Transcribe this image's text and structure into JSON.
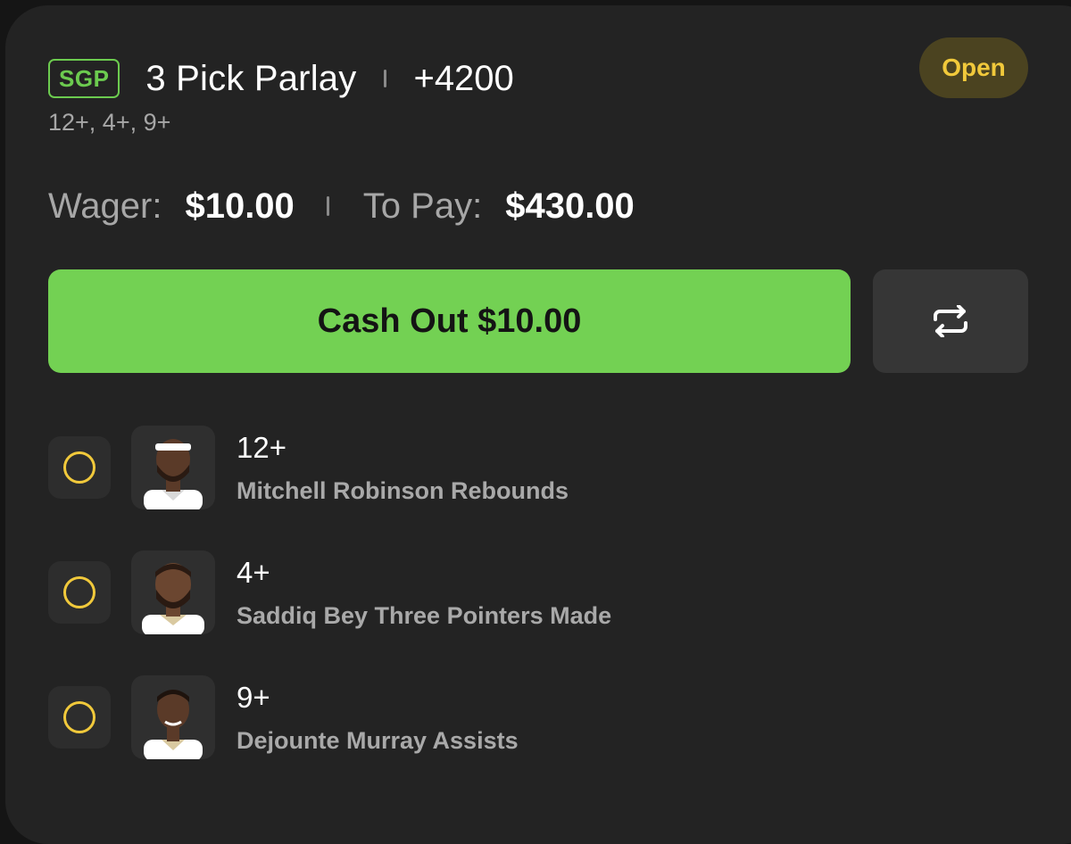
{
  "bet": {
    "badge": "SGP",
    "title": "3 Pick Parlay",
    "odds": "+4200",
    "subtitle": "12+, 4+, 9+",
    "status": "Open"
  },
  "wager": {
    "wager_label": "Wager:",
    "wager_value": "$10.00",
    "topay_label": "To Pay:",
    "topay_value": "$430.00"
  },
  "actions": {
    "cashout_label": "Cash Out $10.00",
    "repeat_icon": "repeat-icon"
  },
  "legs": [
    {
      "line": "12+",
      "description": "Mitchell Robinson Rebounds",
      "jersey": "#ffffff",
      "status_icon": "pending-circle-icon"
    },
    {
      "line": "4+",
      "description": "Saddiq Bey Three Pointers Made",
      "jersey": "#ffffff",
      "status_icon": "pending-circle-icon"
    },
    {
      "line": "9+",
      "description": "Dejounte Murray Assists",
      "jersey": "#ffffff",
      "status_icon": "pending-circle-icon"
    }
  ],
  "colors": {
    "accent_green": "#73d153",
    "pending_yellow": "#f1c93b",
    "card_bg": "#232323"
  }
}
